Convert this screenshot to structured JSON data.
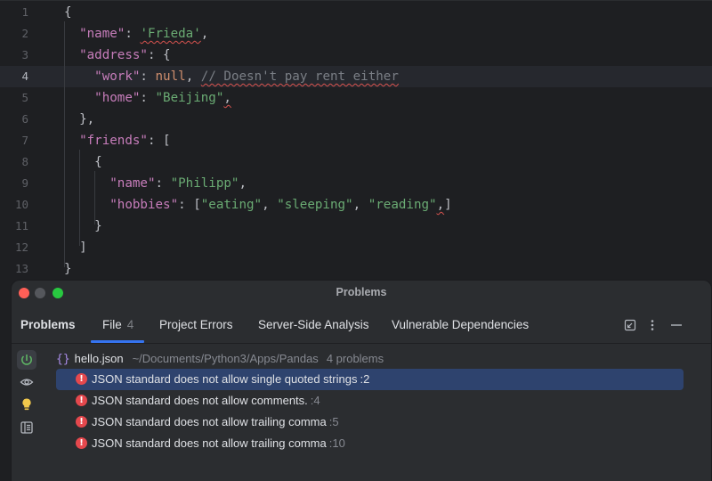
{
  "editor": {
    "line_numbers": [
      "1",
      "2",
      "3",
      "4",
      "5",
      "6",
      "7",
      "8",
      "9",
      "10",
      "11",
      "12",
      "13"
    ],
    "lines": [
      {
        "indent": "",
        "tokens": [
          {
            "t": "p",
            "v": "{"
          }
        ]
      },
      {
        "indent": "  ",
        "tokens": [
          {
            "t": "k",
            "v": "\"name\""
          },
          {
            "t": "p",
            "v": ": "
          },
          {
            "t": "s",
            "v": "'Frieda'",
            "w": true
          },
          {
            "t": "p",
            "v": ","
          }
        ]
      },
      {
        "indent": "  ",
        "tokens": [
          {
            "t": "k",
            "v": "\"address\""
          },
          {
            "t": "p",
            "v": ": {"
          }
        ]
      },
      {
        "indent": "    ",
        "tokens": [
          {
            "t": "k",
            "v": "\"work\""
          },
          {
            "t": "p",
            "v": ": "
          },
          {
            "t": "n",
            "v": "null"
          },
          {
            "t": "p",
            "v": ", "
          },
          {
            "t": "c",
            "v": "// Doesn't pay rent either",
            "w": true
          }
        ]
      },
      {
        "indent": "    ",
        "tokens": [
          {
            "t": "k",
            "v": "\"home\""
          },
          {
            "t": "p",
            "v": ": "
          },
          {
            "t": "s",
            "v": "\"Beijing\""
          },
          {
            "t": "p",
            "v": ",",
            "w": true
          }
        ]
      },
      {
        "indent": "  ",
        "tokens": [
          {
            "t": "p",
            "v": "},"
          }
        ]
      },
      {
        "indent": "  ",
        "tokens": [
          {
            "t": "k",
            "v": "\"friends\""
          },
          {
            "t": "p",
            "v": ": ["
          }
        ]
      },
      {
        "indent": "    ",
        "tokens": [
          {
            "t": "p",
            "v": "{"
          }
        ]
      },
      {
        "indent": "      ",
        "tokens": [
          {
            "t": "k",
            "v": "\"name\""
          },
          {
            "t": "p",
            "v": ": "
          },
          {
            "t": "s",
            "v": "\"Philipp\""
          },
          {
            "t": "p",
            "v": ","
          }
        ]
      },
      {
        "indent": "      ",
        "tokens": [
          {
            "t": "k",
            "v": "\"hobbies\""
          },
          {
            "t": "p",
            "v": ": ["
          },
          {
            "t": "s",
            "v": "\"eating\""
          },
          {
            "t": "p",
            "v": ", "
          },
          {
            "t": "s",
            "v": "\"sleeping\""
          },
          {
            "t": "p",
            "v": ", "
          },
          {
            "t": "s",
            "v": "\"reading\""
          },
          {
            "t": "p",
            "v": ",",
            "w": true
          },
          {
            "t": "p",
            "v": "]"
          }
        ]
      },
      {
        "indent": "    ",
        "tokens": [
          {
            "t": "p",
            "v": "}"
          }
        ]
      },
      {
        "indent": "  ",
        "tokens": [
          {
            "t": "p",
            "v": "]"
          }
        ]
      },
      {
        "indent": "",
        "tokens": [
          {
            "t": "p",
            "v": "}"
          }
        ]
      }
    ],
    "current_line": 4
  },
  "problems_window": {
    "title": "Problems",
    "header_label": "Problems",
    "tabs": [
      {
        "label": "File",
        "count": "4"
      },
      {
        "label": "Project Errors"
      },
      {
        "label": "Server-Side Analysis"
      },
      {
        "label": "Vulnerable Dependencies"
      }
    ],
    "toolbar_icons": [
      "expand-icon",
      "more-vertical-icon",
      "minimize-icon"
    ],
    "sidebar_icons": [
      "refresh-icon",
      "eye-icon",
      "lightbulb-icon",
      "preview-icon"
    ],
    "file": {
      "icon": "{}",
      "name": "hello.json",
      "path": "~/Documents/Python3/Apps/Pandas",
      "count": "4 problems"
    },
    "problems": [
      {
        "message": "JSON standard does not allow single quoted strings",
        "line": ":2"
      },
      {
        "message": "JSON standard does not allow comments.",
        "line": ":4"
      },
      {
        "message": "JSON standard does not allow trailing comma",
        "line": ":5"
      },
      {
        "message": "JSON standard does not allow trailing comma",
        "line": ":10"
      }
    ],
    "selected_index": 0,
    "error_glyph": "!"
  },
  "colors": {
    "accent": "#3574f0",
    "selection": "#2e436e",
    "error": "#e5484d",
    "json_key": "#c77dbb",
    "json_string": "#6aab73",
    "json_null": "#cf8e6d",
    "comment": "#7a7e85"
  }
}
